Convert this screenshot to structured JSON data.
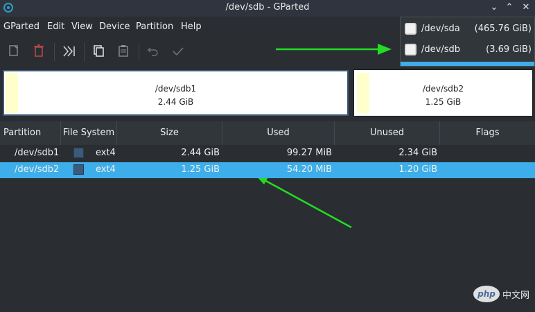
{
  "window": {
    "title": "/dev/sdb - GParted"
  },
  "menu": [
    "GParted",
    "Edit",
    "View",
    "Device",
    "Partition",
    "Help"
  ],
  "toolbar": {
    "buttons": [
      "new-partition-icon",
      "delete-icon",
      "resize-move-icon",
      "copy-icon",
      "paste-icon",
      "undo-icon",
      "apply-icon"
    ]
  },
  "disk_map": {
    "partitions": [
      {
        "name": "/dev/sdb1",
        "size": "2.44 GiB"
      },
      {
        "name": "/dev/sdb2",
        "size": "1.25 GiB"
      }
    ]
  },
  "table": {
    "headers": [
      "Partition",
      "File System",
      "Size",
      "Used",
      "Unused",
      "Flags"
    ],
    "rows": [
      {
        "partition": "/dev/sdb1",
        "filesystem": "ext4",
        "size": "2.44 GiB",
        "used": "99.27 MiB",
        "unused": "2.34 GiB",
        "flags": ""
      },
      {
        "partition": "/dev/sdb2",
        "filesystem": "ext4",
        "size": "1.25 GiB",
        "used": "54.20 MiB",
        "unused": "1.20 GiB",
        "flags": ""
      }
    ]
  },
  "device_dropdown": {
    "items": [
      {
        "name": "/dev/sda",
        "size": "(465.76 GiB)"
      },
      {
        "name": "/dev/sdb",
        "size": "(3.69 GiB)"
      }
    ]
  },
  "watermark": {
    "logo": "php",
    "text": "中文网"
  },
  "colors": {
    "selection": "#3daee9",
    "annotation_arrow": "#22dd22",
    "ext4": "#3c5a7a"
  }
}
